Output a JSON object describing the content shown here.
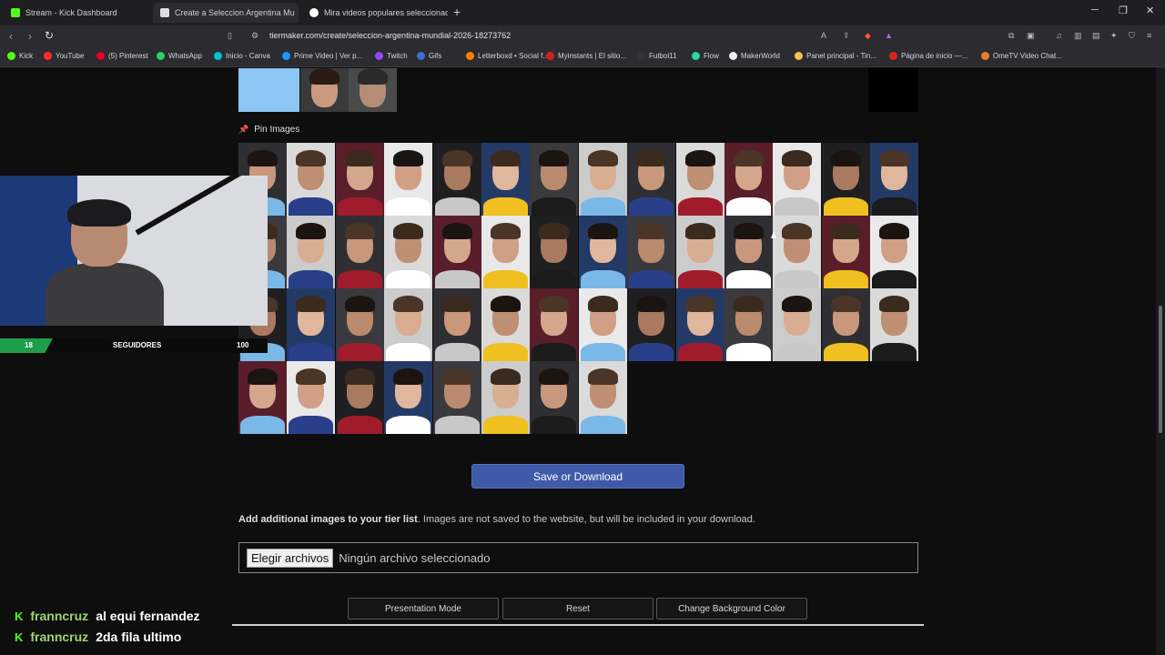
{
  "browser": {
    "tabs": [
      {
        "label": "Stream - Kick Dashboard",
        "favicon_color": "#53fc18"
      },
      {
        "label": "Create a Seleccion Argentina Mu",
        "favicon_color": "#dddddd",
        "active": true
      },
      {
        "label": "Mira videos populares seleccionados",
        "favicon_color": "#ffffff"
      }
    ],
    "url": "tiermaker.com/create/seleccion-argentina-mundial-2026-18273762",
    "bookmarks": [
      {
        "label": "Kick",
        "color": "#53fc18"
      },
      {
        "label": "YouTube",
        "color": "#ff2a2a"
      },
      {
        "label": "(5) Pinterest",
        "color": "#e60023"
      },
      {
        "label": "WhatsApp",
        "color": "#25d366"
      },
      {
        "label": "Inicio - Canva",
        "color": "#00c4cc"
      },
      {
        "label": "Prime Video | Ver p...",
        "color": "#1a98ff"
      },
      {
        "label": "Twitch",
        "color": "#9146ff"
      },
      {
        "label": "Gifs",
        "color": "#3b6fd1"
      },
      {
        "label": "Letterboxd • Social f...",
        "color": "#ff8000"
      },
      {
        "label": "Myinstants | El sitio...",
        "color": "#d12323"
      },
      {
        "label": "Futbol11",
        "color": "#333333"
      },
      {
        "label": "Flow",
        "color": "#2bd4a4"
      },
      {
        "label": "MakerWorld",
        "color": "#eeeeee"
      },
      {
        "label": "Panel principal - Tin...",
        "color": "#f2c14e"
      },
      {
        "label": "Página de inicio —...",
        "color": "#e02020"
      },
      {
        "label": "OmeTV Video Chat...",
        "color": "#e87d2f"
      }
    ]
  },
  "page": {
    "pin_label": "Pin Images",
    "save_button": "Save or Download",
    "add_text_bold": "Add additional images to your tier list",
    "add_text_rest": ". Images are not saved to the website, but will be included in your download.",
    "file_button": "Elegir archivos",
    "file_status": "Ningún archivo seleccionado",
    "buttons": {
      "presentation": "Presentation Mode",
      "reset": "Reset",
      "change_bg": "Change Background Color"
    }
  },
  "overlay": {
    "stat_left": "18",
    "stat_mid": "SEGUIDORES",
    "stat_right": "100",
    "chat": [
      {
        "user": "franncruz",
        "message": "al equi fernandez"
      },
      {
        "user": "franncruz",
        "message": "2da fila ultimo"
      }
    ]
  }
}
